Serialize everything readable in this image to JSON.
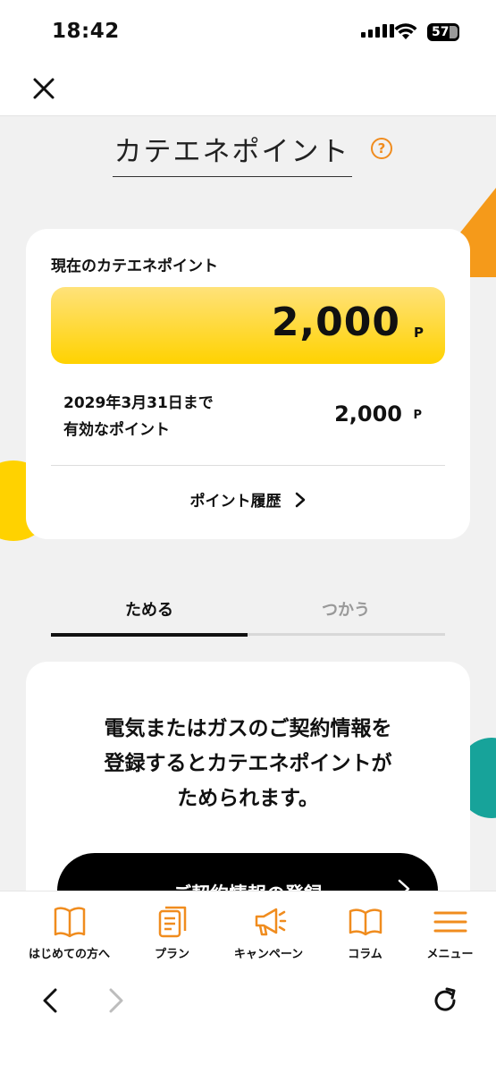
{
  "status_bar": {
    "time": "18:42",
    "battery": "57"
  },
  "colors": {
    "accent_orange": "#f08c1e",
    "yellow": "#ffd200",
    "teal": "#17a39a"
  },
  "header": {
    "close_icon": "close-icon"
  },
  "page": {
    "title": "カテエネポイント",
    "help_icon": "?"
  },
  "points_card": {
    "label": "現在のカテエネポイント",
    "value": "2,000",
    "unit": "P",
    "expiry_label": "2029年3月31日まで\n有効なポイント",
    "expiry_value": "2,000",
    "expiry_unit": "P",
    "history_link": "ポイント履歴"
  },
  "tabs": [
    {
      "label": "ためる",
      "active": true
    },
    {
      "label": "つかう",
      "active": false
    }
  ],
  "info_card": {
    "text": "電気またはガスのご契約情報を\n登録するとカテエネポイントが\nためられます。",
    "button_label": "ご契約情報の登録"
  },
  "bottom_nav": [
    {
      "label": "はじめての方へ",
      "icon": "book-icon"
    },
    {
      "label": "プラン",
      "icon": "document-icon"
    },
    {
      "label": "キャンペーン",
      "icon": "megaphone-icon"
    },
    {
      "label": "コラム",
      "icon": "open-book-icon"
    },
    {
      "label": "メニュー",
      "icon": "menu-icon"
    }
  ]
}
